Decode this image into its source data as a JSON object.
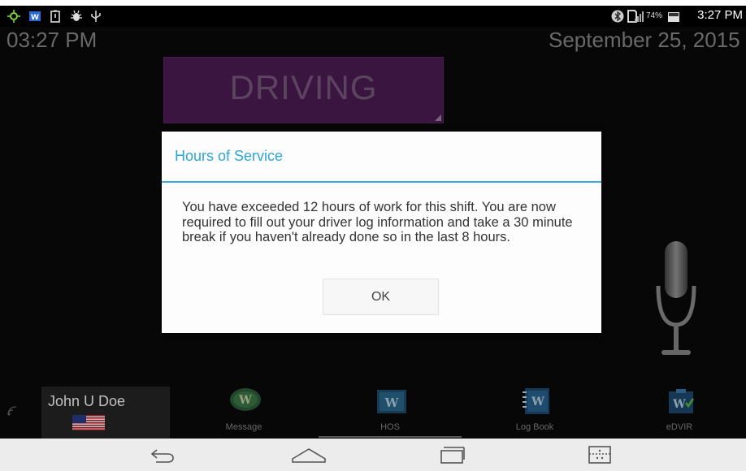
{
  "status_bar": {
    "left_icons": [
      "brightness-icon",
      "app-w-icon",
      "battery-alert-icon",
      "bug-icon",
      "usb-icon"
    ],
    "right_icons": [
      "bluetooth-icon",
      "sim-icon",
      "signal-icon"
    ],
    "battery_percent": "74%",
    "time": "3:27 PM"
  },
  "clock": {
    "time": "03:27 PM",
    "date": "September 25, 2015"
  },
  "status_panel": {
    "label": "DRIVING",
    "color": "#4c1d54"
  },
  "dialog": {
    "title": "Hours of Service",
    "message": "You have exceeded 12 hours of work for this shift. You are now required to fill out your driver log information and take a 30 minute break if you haven't already done so in the last 8 hours.",
    "ok_label": "OK",
    "accent": "#2ea6d7"
  },
  "user": {
    "name": "John U Doe",
    "flag": "us-flag-icon"
  },
  "dock": {
    "items": [
      {
        "label": "Message",
        "icon": "message-icon"
      },
      {
        "label": "HOS",
        "icon": "hos-icon"
      },
      {
        "label": "Log Book",
        "icon": "logbook-icon"
      },
      {
        "label": "eDVIR",
        "icon": "edvir-icon"
      }
    ]
  },
  "nav_bar": {
    "buttons": [
      "back-icon",
      "home-icon",
      "recents-icon",
      "menu-icon"
    ]
  }
}
